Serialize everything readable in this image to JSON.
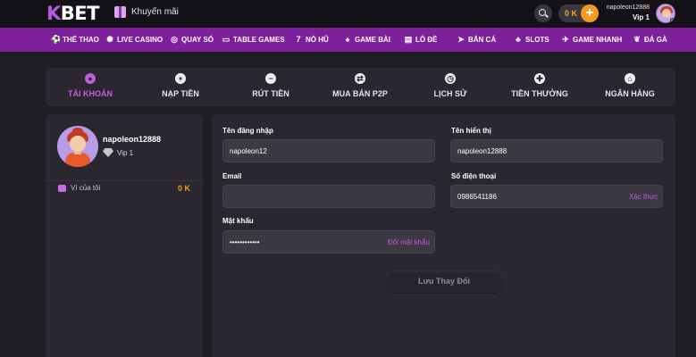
{
  "header": {
    "logo_text_k": "K",
    "logo_text_rest": "BET",
    "promo_label": "Khuyến mãi",
    "balance": "0 K",
    "plus_symbol": "+",
    "username": "napoleon12888",
    "vip": "Vip 1"
  },
  "menu": [
    {
      "label": "THỂ THAO",
      "icon": "soccer-ball-icon",
      "glyph": "⚽"
    },
    {
      "label": "LIVE CASINO",
      "icon": "casino-chip-icon",
      "glyph": "✺"
    },
    {
      "label": "QUAY SỐ",
      "icon": "lottery-wheel-icon",
      "glyph": "◎"
    },
    {
      "label": "TABLE GAMES",
      "icon": "table-games-icon",
      "glyph": "▭"
    },
    {
      "label": "NỔ HŨ",
      "icon": "slot-seven-icon",
      "glyph": "7"
    },
    {
      "label": "GAME BÀI",
      "icon": "card-game-icon",
      "glyph": "♠"
    },
    {
      "label": "LÔ ĐỀ",
      "icon": "lottery-ticket-icon",
      "glyph": "▤"
    },
    {
      "label": "BẮN CÁ",
      "icon": "fish-icon",
      "glyph": "➤"
    },
    {
      "label": "SLOTS",
      "icon": "cherries-icon",
      "glyph": "♣"
    },
    {
      "label": "GAME NHANH",
      "icon": "rocket-icon",
      "glyph": "✈"
    },
    {
      "label": "ĐÁ GÀ",
      "icon": "rooster-icon",
      "glyph": "❦"
    }
  ],
  "tabs": [
    {
      "label": "TÀI KHOẢN",
      "icon": "user-icon",
      "glyph": "●",
      "active": true
    },
    {
      "label": "NẠP TIỀN",
      "icon": "plus-circle-icon",
      "glyph": "+",
      "active": false
    },
    {
      "label": "RÚT TIỀN",
      "icon": "minus-circle-icon",
      "glyph": "−",
      "active": false
    },
    {
      "label": "MUA BÁN P2P",
      "icon": "exchange-icon",
      "glyph": "⇄",
      "active": false
    },
    {
      "label": "LỊCH SỬ",
      "icon": "clock-icon",
      "glyph": "◷",
      "active": false
    },
    {
      "label": "TIỀN THƯỞNG",
      "icon": "gift-icon",
      "glyph": "✚",
      "active": false
    },
    {
      "label": "NGÂN HÀNG",
      "icon": "bank-icon",
      "glyph": "⌂",
      "active": false
    }
  ],
  "profile": {
    "name": "napoleon12888",
    "vip": "Vip 1",
    "wallet_label": "Ví của tôi",
    "wallet_amount": "0 K"
  },
  "form": {
    "username_label": "Tên đăng nhập",
    "username_value": "napoleon12",
    "display_label": "Tên hiển thị",
    "display_value": "napoleon12888",
    "email_label": "Email",
    "email_value": "",
    "phone_label": "Số điện thoại",
    "phone_value": "0986541186",
    "verify_link": "Xác thực",
    "password_label": "Mật khẩu",
    "password_value": "••••••••••••",
    "change_password_link": "Đổi mật khẩu",
    "save_button": "Lưu Thay Đổi"
  },
  "colors": {
    "accent": "#c25de0",
    "menu_bar": "#7e1f9b",
    "balance": "#f39c1f"
  }
}
